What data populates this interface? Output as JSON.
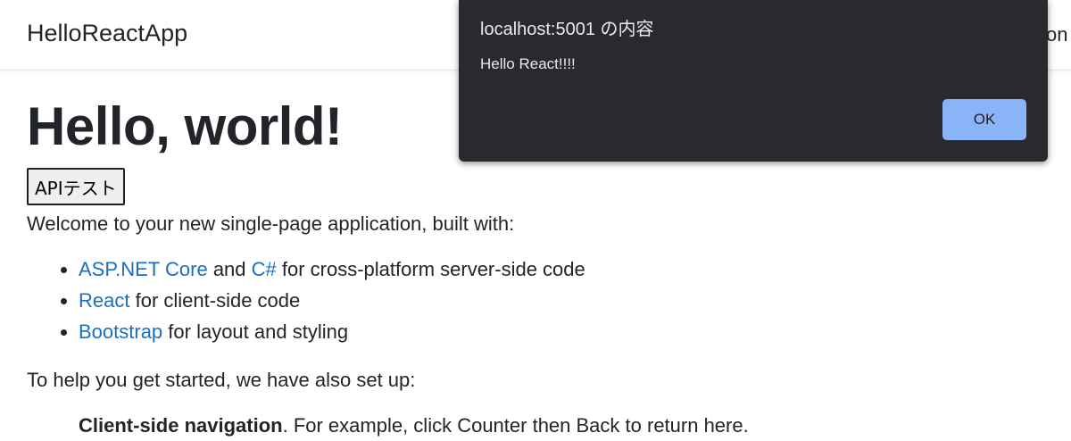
{
  "navbar": {
    "brand": "HelloReactApp",
    "right_fragment": "on"
  },
  "main": {
    "heading": "Hello, world!",
    "api_button_label": "APIテスト",
    "intro": "Welcome to your new single-page application, built with:",
    "tech_list": [
      {
        "link1": "ASP.NET Core",
        "mid": " and ",
        "link2": "C#",
        "rest": " for cross-platform server-side code"
      },
      {
        "link1": "React",
        "rest": " for client-side code"
      },
      {
        "link1": "Bootstrap",
        "rest": " for layout and styling"
      }
    ],
    "help_intro": "To help you get started, we have also set up:",
    "cut_item_bold": "Client-side navigation",
    "cut_item_rest": ". For example, click Counter then Back to return here."
  },
  "dialog": {
    "title": "localhost:5001 の内容",
    "message": "Hello React!!!!",
    "ok_label": "OK"
  },
  "colors": {
    "link": "#1b6ec2",
    "dialog_bg": "#292a2d",
    "ok_button": "#8ab4f8"
  }
}
